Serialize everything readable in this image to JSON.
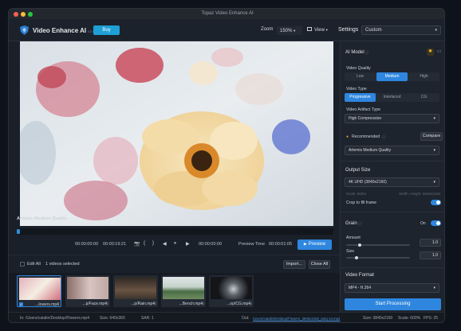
{
  "window": {
    "title": "Topaz Video Enhance AI"
  },
  "toolbar": {
    "app_name": "Video Enhance AI",
    "version": "v2.6.4",
    "buy_label": "Buy",
    "zoom_label": "Zoom",
    "zoom_value": "150%",
    "view_label": "View",
    "settings_label": "Settings",
    "preset_value": "Custom"
  },
  "preview": {
    "model_label": "Artemis Medium Quality",
    "timecode_start": "00:00:00:00",
    "timecode_current": "00:00:19:21",
    "timecode_mark": "00:00:00:00",
    "preview_time_label": "Preview Time",
    "preview_time_value": "00:00:01:05",
    "preview_button": "Preview",
    "marker_in": "{",
    "marker_out": "}",
    "icons": {
      "camera": "📷",
      "prev": "◀",
      "pause": "⏸",
      "next": "▶"
    }
  },
  "edit": {
    "edit_all": "Edit All",
    "selected": "1 videos selected",
    "import_button": "Import...",
    "close_all_button": "Close All"
  },
  "thumbnails": [
    {
      "name": "...lowers.mp4",
      "bg": "#c9a7ad",
      "selected": true
    },
    {
      "name": "...p/Face.mp4",
      "bg": "#b9a7a3",
      "selected": false
    },
    {
      "name": "...p/Rain.mp4",
      "bg": "#4a4036",
      "selected": false
    },
    {
      "name": "...Bench.mp4",
      "bg": "#8ea79a",
      "selected": false
    },
    {
      "name": "...op/CG.mp4",
      "bg": "#2e3136",
      "selected": false
    }
  ],
  "status": {
    "in_path": "In: /Users/catalin/Desktop/Flowers.mp4",
    "in_size": "Size: 640x360",
    "in_sar": "SAR: 1",
    "out_label": "Out:",
    "out_path": "/Users/catalin/Desktop/Flowers_3840x2160_amq-13.mp4",
    "out_size": "Size: 3840x2160",
    "scale": "Scale: 600%",
    "fps": "FPS: 25"
  },
  "settings": {
    "ai_model_header": "AI Model",
    "video_quality_label": "Video Quality",
    "quality_options": [
      "Low",
      "Medium",
      "High"
    ],
    "quality_selected": "Medium",
    "video_type_label": "Video Type",
    "type_options": [
      "Progressive",
      "Interlaced",
      "CG"
    ],
    "type_selected": "Progressive",
    "artifact_label": "Video Artifact Type",
    "artifact_value": "High Compression",
    "recommended_label": "Recommended",
    "compare_button": "Compare",
    "model_value": "Artemis Medium Quality",
    "output_size_header": "Output Size",
    "output_size_value": "4K UHD (3840x2160)",
    "scale_text": "Scale: 600%",
    "dimension_text": "Width, Height: 3840x2160",
    "crop_label": "Crop to fill frame",
    "crop_on": true,
    "grain_header": "Grain",
    "grain_state": "On",
    "amount_label": "Amount",
    "amount_value": "1.0",
    "size_label": "Size",
    "size_value": "1.0",
    "video_format_header": "Video Format",
    "format_value": "MP4 - H.264",
    "start_button": "Start Processing"
  },
  "colors": {
    "accent": "#2e86de",
    "buy": "#1e9fd6",
    "recommended": "#e0a030"
  }
}
